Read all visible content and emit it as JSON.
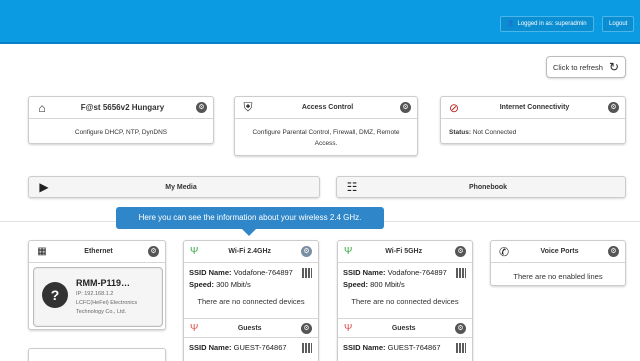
{
  "topbar": {
    "user_label": "Logged in as: superadmin",
    "logout_label": "Logout"
  },
  "refresh": {
    "label": "Click to refresh"
  },
  "cards": {
    "router": {
      "title": "F@st 5656v2 Hungary",
      "body": "Configure DHCP, NTP, DynDNS"
    },
    "access": {
      "title": "Access Control",
      "body": "Configure Parental Control, Firewall, DMZ, Remote Access."
    },
    "internet": {
      "title": "Internet Connectivity",
      "status_label": "Status:",
      "status_value": "Not Connected"
    }
  },
  "media": {
    "label": "My Media"
  },
  "phonebook": {
    "label": "Phonebook"
  },
  "tooltip": {
    "text": "Here you can see the information about your wireless 2.4 GHz."
  },
  "ethernet": {
    "title": "Ethernet",
    "device_name": "RMM-P119…",
    "device_ip": "IP: 192.168.1.2",
    "device_vendor": "LCFC(HeFei) Electronics Technology Co., Ltd."
  },
  "wifi24": {
    "title": "Wi-Fi 2.4GHz",
    "ssid_label": "SSID Name:",
    "ssid": "Vodafone-764897",
    "speed_label": "Speed:",
    "speed": "300 Mbit/s",
    "empty": "There are no connected devices",
    "guests_title": "Guests",
    "guest_ssid": "GUEST-764867"
  },
  "wifi5": {
    "title": "Wi-Fi 5GHz",
    "ssid_label": "SSID Name:",
    "ssid": "Vodafone-764897",
    "speed_label": "Speed:",
    "speed": "800 Mbit/s",
    "empty": "There are no connected devices",
    "guests_title": "Guests",
    "guest_ssid": "GUEST-764867"
  },
  "voice": {
    "title": "Voice Ports",
    "empty": "There are no enabled lines"
  }
}
